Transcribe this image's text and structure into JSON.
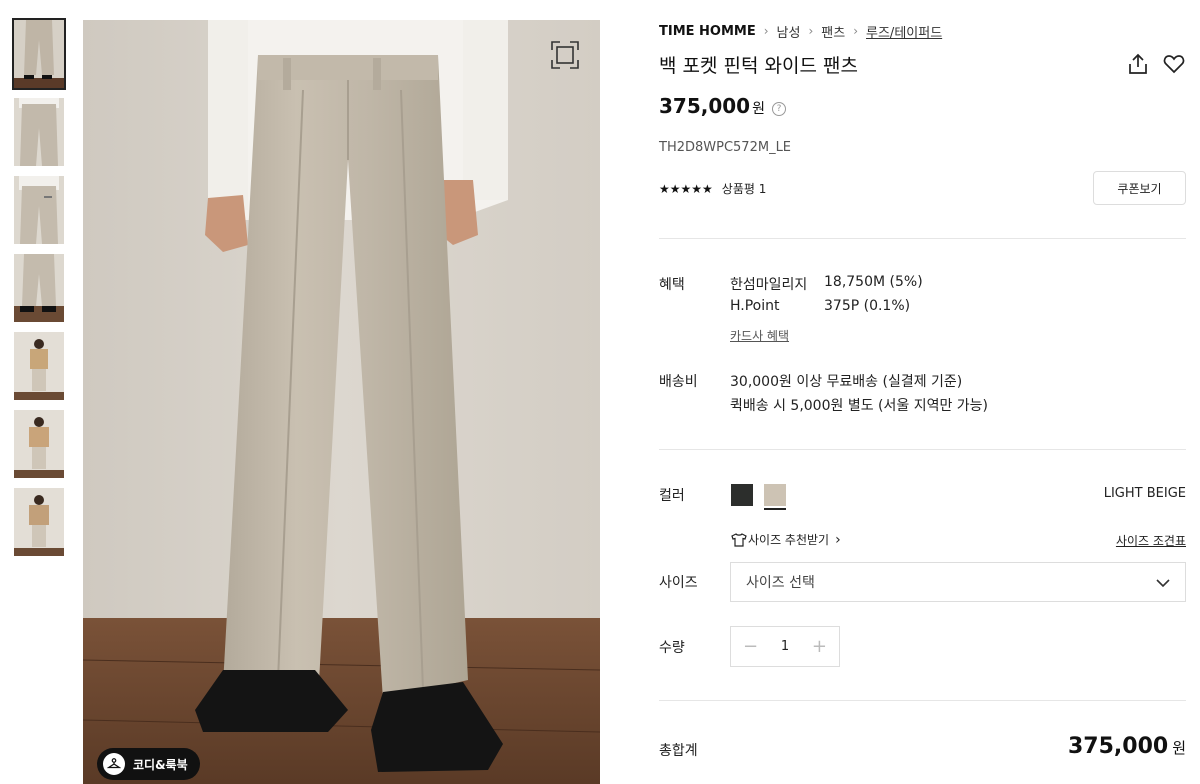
{
  "breadcrumb": {
    "brand": "TIME HOMME",
    "level1": "남성",
    "level2": "팬츠",
    "current": "루즈/테이퍼드"
  },
  "product": {
    "title": "백 포켓 핀턱 와이드 팬츠",
    "price": "375,000",
    "currency": "원",
    "code": "TH2D8WPC572M_LE",
    "rating_stars": "★★★★★",
    "review_label": "상품평 1",
    "coupon_button": "쿠폰보기"
  },
  "benefits": {
    "label": "혜택",
    "rows": [
      {
        "name": "한섬마일리지",
        "value": "18,750M (5%)"
      },
      {
        "name": "H.Point",
        "value": "375P (0.1%)"
      }
    ],
    "card_link": "카드사 혜택"
  },
  "shipping": {
    "label": "배송비",
    "line1": "30,000원 이상 무료배송 (실결제 기준)",
    "line2": "퀵배송 시 5,000원 별도 (서울 지역만 가능)"
  },
  "color": {
    "label": "컬러",
    "selected_name": "LIGHT BEIGE",
    "swatches": [
      "#2c2e2c",
      "#cdc3b4"
    ]
  },
  "size": {
    "recommend_link": "사이즈 추천받기",
    "chart_link": "사이즈 조견표",
    "label": "사이즈",
    "placeholder": "사이즈 선택"
  },
  "quantity": {
    "label": "수량",
    "minus": "−",
    "value": "1",
    "plus": "+"
  },
  "total": {
    "label": "총합계",
    "price": "375,000",
    "currency": "원"
  },
  "image": {
    "look_button": "코디&룩북"
  },
  "icons": {
    "expand": "expand-icon",
    "share": "share-icon",
    "wishlist": "heart-icon",
    "help": "question-icon",
    "shirt": "shirt-icon",
    "chevron": "chevron-down-icon"
  }
}
